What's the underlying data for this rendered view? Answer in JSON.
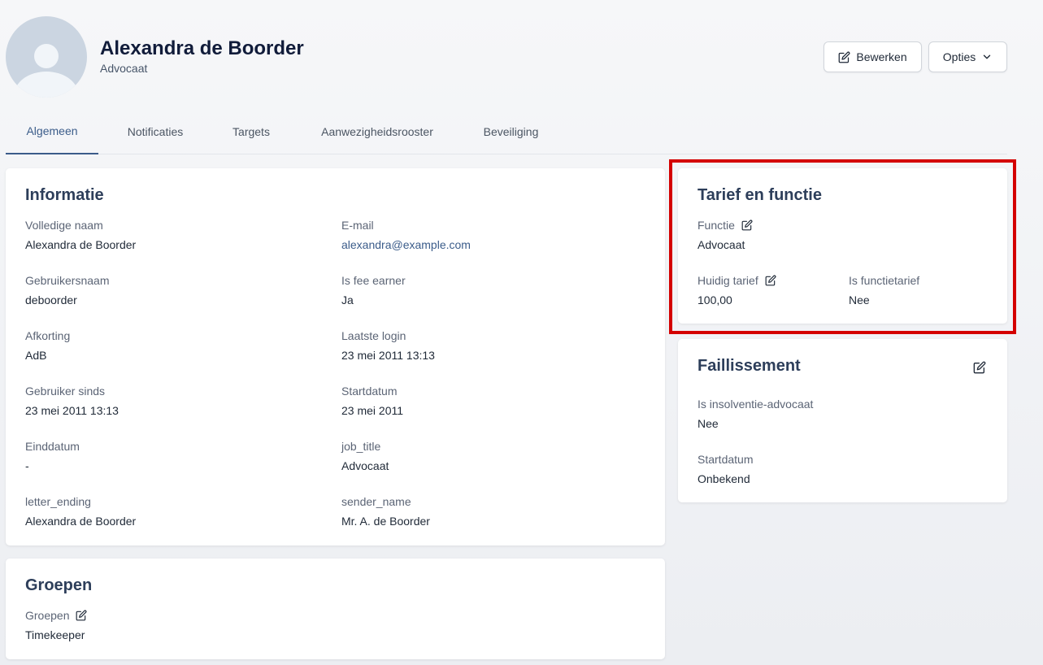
{
  "header": {
    "name": "Alexandra de Boorder",
    "role": "Advocaat",
    "edit_label": "Bewerken",
    "options_label": "Opties"
  },
  "tabs": [
    {
      "label": "Algemeen",
      "active": true
    },
    {
      "label": "Notificaties",
      "active": false
    },
    {
      "label": "Targets",
      "active": false
    },
    {
      "label": "Aanwezigheidsrooster",
      "active": false
    },
    {
      "label": "Beveiliging",
      "active": false
    }
  ],
  "informatie": {
    "title": "Informatie",
    "fields": [
      {
        "label": "Volledige naam",
        "value": "Alexandra de Boorder"
      },
      {
        "label": "E-mail",
        "value": "alexandra@example.com"
      },
      {
        "label": "Gebruikersnaam",
        "value": "deboorder"
      },
      {
        "label": "Is fee earner",
        "value": "Ja"
      },
      {
        "label": "Afkorting",
        "value": "AdB"
      },
      {
        "label": "Laatste login",
        "value": "23 mei 2011 13:13"
      },
      {
        "label": "Gebruiker sinds",
        "value": "23 mei 2011 13:13"
      },
      {
        "label": "Startdatum",
        "value": "23 mei 2011"
      },
      {
        "label": "Einddatum",
        "value": "-"
      },
      {
        "label": "job_title",
        "value": "Advocaat"
      },
      {
        "label": "letter_ending",
        "value": "Alexandra de Boorder"
      },
      {
        "label": "sender_name",
        "value": "Mr. A. de Boorder"
      }
    ]
  },
  "groepen": {
    "title": "Groepen",
    "label": "Groepen",
    "value": "Timekeeper"
  },
  "tarief": {
    "title": "Tarief en functie",
    "functie_label": "Functie",
    "functie_value": "Advocaat",
    "huidig_label": "Huidig tarief",
    "huidig_value": "100,00",
    "isfunctie_label": "Is functietarief",
    "isfunctie_value": "Nee"
  },
  "faillissement": {
    "title": "Faillissement",
    "insolventie_label": "Is insolventie-advocaat",
    "insolventie_value": "Nee",
    "startdatum_label": "Startdatum",
    "startdatum_value": "Onbekend"
  },
  "colors": {
    "accent": "#3b5c8a",
    "highlight": "#d40000",
    "title": "#2d3e5a"
  }
}
